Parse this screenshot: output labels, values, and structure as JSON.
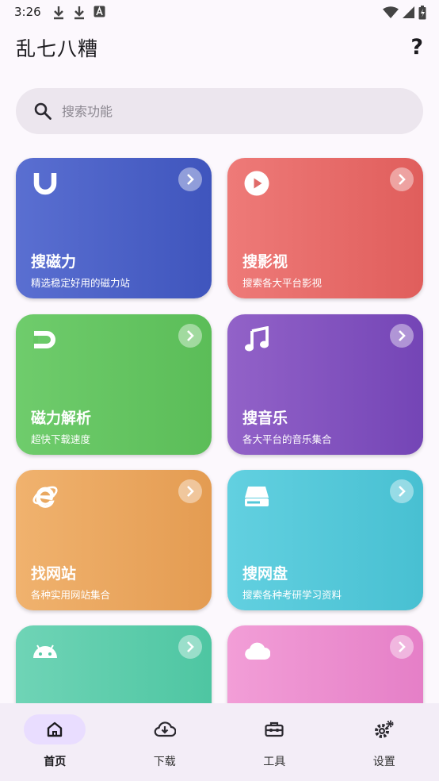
{
  "status": {
    "time": "3:26"
  },
  "app": {
    "title": "乱七八糟",
    "help": "?"
  },
  "search": {
    "placeholder": "搜索功能"
  },
  "cards": [
    {
      "title": "搜磁力",
      "desc": "精选稳定好用的磁力站",
      "icon": "magnet-u-icon",
      "from": "#5a6fd1",
      "to": "#3f55bd"
    },
    {
      "title": "搜影视",
      "desc": "搜索各大平台影视",
      "icon": "play-circle-icon",
      "from": "#ee7a78",
      "to": "#e05e5c"
    },
    {
      "title": "磁力解析",
      "desc": "超快下载速度",
      "icon": "magnet-horizontal-icon",
      "from": "#6fcc6c",
      "to": "#5bbd58"
    },
    {
      "title": "搜音乐",
      "desc": "各大平台的音乐集合",
      "icon": "music-note-icon",
      "from": "#9262c8",
      "to": "#7445b6"
    },
    {
      "title": "找网站",
      "desc": "各种实用网站集合",
      "icon": "internet-explorer-icon",
      "from": "#f0b26e",
      "to": "#e49c52"
    },
    {
      "title": "搜网盘",
      "desc": "搜索各种考研学习资料",
      "icon": "hard-drive-icon",
      "from": "#62d0e0",
      "to": "#48c0d2"
    },
    {
      "title": "",
      "desc": "",
      "icon": "android-icon",
      "from": "#6fd4b6",
      "to": "#4ec6a2"
    },
    {
      "title": "",
      "desc": "",
      "icon": "cloud-icon",
      "from": "#f29ed7",
      "to": "#e57fc7"
    }
  ],
  "nav": [
    {
      "label": "首页",
      "icon": "home-icon",
      "active": true
    },
    {
      "label": "下载",
      "icon": "cloud-download-icon",
      "active": false
    },
    {
      "label": "工具",
      "icon": "toolbox-icon",
      "active": false
    },
    {
      "label": "设置",
      "icon": "settings-gears-icon",
      "active": false
    }
  ]
}
